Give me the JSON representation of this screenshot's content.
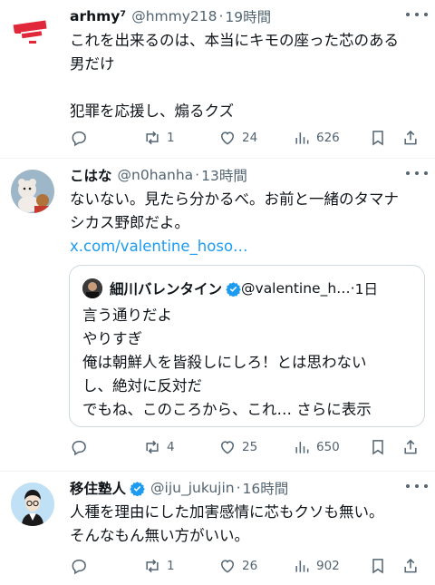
{
  "tweets": [
    {
      "name": "arhmy⁷",
      "handle": "@hmmy218",
      "time": "19時間",
      "body": [
        "これを出来るのは、本当にキモの座った芯のある",
        "男だけ",
        "",
        "犯罪を応援し、煽るクズ"
      ],
      "replies": "",
      "retweets": "1",
      "likes": "24",
      "views": "626"
    },
    {
      "name": "こはな",
      "handle": "@n0hanha",
      "time": "13時間",
      "body": [
        "ないない。見たら分かるべ。お前と一緒のタマナ",
        "シカス野郎だよ。"
      ],
      "link": "x.com/valentine_hoso…",
      "quote": {
        "name": "細川バレンタイン",
        "handle": "@valentine_h…",
        "time": "1日",
        "body": [
          "言う通りだよ",
          "やりすぎ",
          "俺は朝鮮人を皆殺しにしろ！とは思わない",
          "し、絶対に反対だ",
          "でもね、このころから、これ… さらに表示"
        ]
      },
      "replies": "",
      "retweets": "4",
      "likes": "25",
      "views": "650"
    },
    {
      "name": "移住塾人",
      "handle": "@iju_jukujin",
      "time": "16時間",
      "body": [
        "人種を理由にした加害感情に芯もクソも無い。",
        "そんなもん無い方がいい。"
      ],
      "replies": "",
      "retweets": "1",
      "likes": "26",
      "views": "902"
    }
  ],
  "separator": "·",
  "colors": {
    "accent": "#1d9bf0",
    "muted": "#536471",
    "text": "#0f1419",
    "verified": "#1d9bf0"
  }
}
